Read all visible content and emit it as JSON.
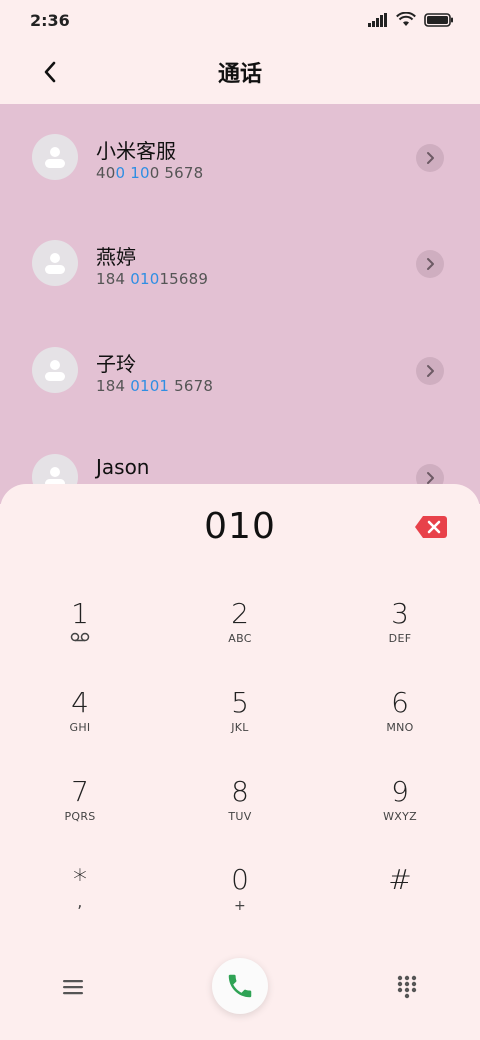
{
  "status": {
    "time": "2:36"
  },
  "header": {
    "title": "通话"
  },
  "contacts": [
    {
      "name": "小米客服",
      "number_parts": [
        "40",
        "0 10",
        "0 5678"
      ]
    },
    {
      "name": "燕婷",
      "number_parts": [
        "184 ",
        "010",
        "15689"
      ]
    },
    {
      "name": "子玲",
      "number_parts": [
        "184 ",
        "0101",
        " 5678"
      ]
    },
    {
      "name": "Jason",
      "number_parts": [
        "",
        "",
        ""
      ]
    }
  ],
  "dialer": {
    "typed": "010",
    "keys": [
      {
        "digit": "1",
        "letters": "voicemail"
      },
      {
        "digit": "2",
        "letters": "ABC"
      },
      {
        "digit": "3",
        "letters": "DEF"
      },
      {
        "digit": "4",
        "letters": "GHI"
      },
      {
        "digit": "5",
        "letters": "JKL"
      },
      {
        "digit": "6",
        "letters": "MNO"
      },
      {
        "digit": "7",
        "letters": "PQRS"
      },
      {
        "digit": "8",
        "letters": "TUV"
      },
      {
        "digit": "9",
        "letters": "WXYZ"
      },
      {
        "digit": "*",
        "letters": ","
      },
      {
        "digit": "0",
        "letters": "+"
      },
      {
        "digit": "#",
        "letters": ""
      }
    ]
  },
  "colors": {
    "background": "#fdeeee",
    "list_overlay": "#e3c1d3",
    "match_highlight": "#2f8ee3",
    "delete": "#e8414a",
    "call": "#2fa355"
  }
}
